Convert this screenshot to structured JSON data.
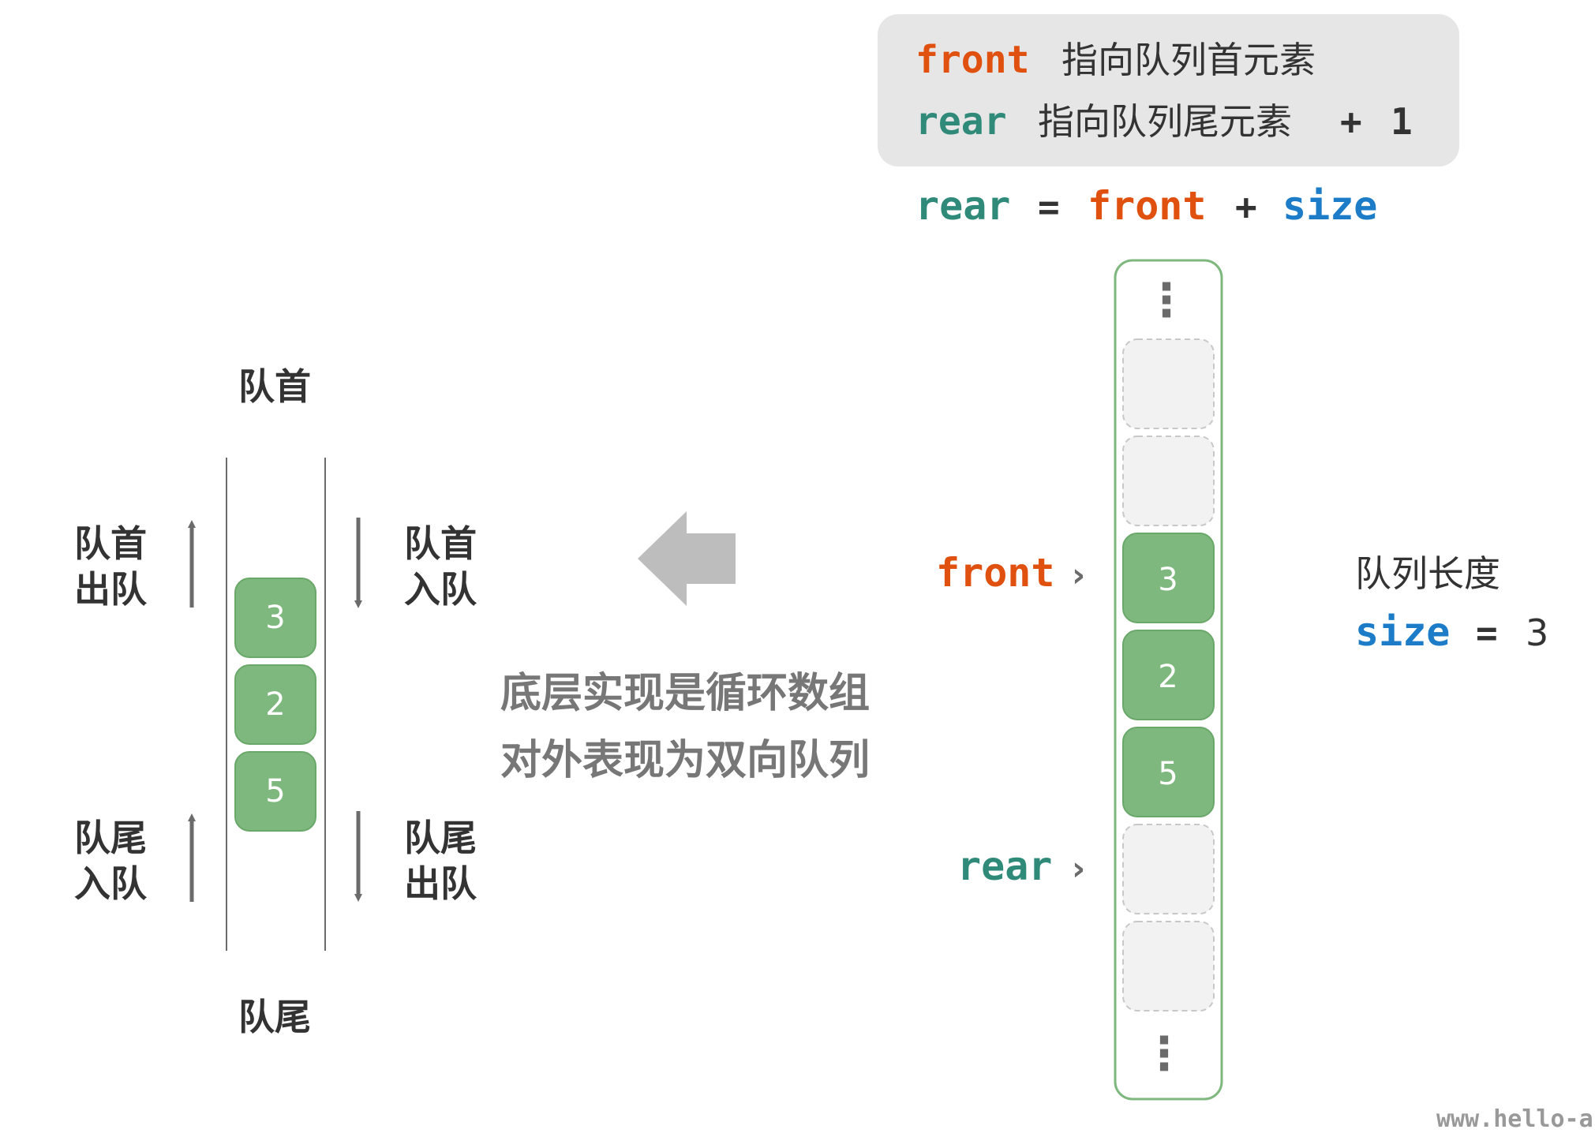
{
  "colors": {
    "front": "#e0500f",
    "rear": "#2f8a7a",
    "size": "#1c7cc7",
    "text": "#333333",
    "muted": "#6b6b6b",
    "cell_fill": "#7eb87e",
    "cell_border": "#6aa86a",
    "empty_fill": "#f2f2f2",
    "empty_border": "#c8c8c8",
    "box_fill": "#e6e6e6",
    "arrow": "#6b6b6b",
    "big_arrow": "#bdbdbd",
    "column_border": "#7eb87e"
  },
  "legend": {
    "line1_keyword": "front",
    "line1_text": "指向队列首元素",
    "line2_keyword": "rear",
    "line2_text": "指向队列尾元素",
    "line2_plus": "+",
    "line2_one": "1"
  },
  "formula": {
    "lhs": "rear",
    "eq": "=",
    "term1": "front",
    "plus": "+",
    "term2": "size"
  },
  "deque": {
    "top_label": "队首",
    "bottom_label": "队尾",
    "values": [
      "3",
      "2",
      "5"
    ],
    "ops": {
      "front_out_1": "队首",
      "front_out_2": "出队",
      "front_in_1": "队首",
      "front_in_2": "入队",
      "rear_in_1": "队尾",
      "rear_in_2": "入队",
      "rear_out_1": "队尾",
      "rear_out_2": "出队"
    }
  },
  "middle": {
    "line1": "底层实现是循环数组",
    "line2": "对外表现为双向队列"
  },
  "array": {
    "ellipsis": "⋮",
    "cells": [
      "",
      "",
      "3",
      "2",
      "5",
      "",
      ""
    ],
    "front_label": "front",
    "rear_label": "rear",
    "pointer": "›"
  },
  "size_info": {
    "title": "队列长度",
    "keyword": "size",
    "eq": "=",
    "value": "3"
  },
  "watermark": "www.hello-a"
}
